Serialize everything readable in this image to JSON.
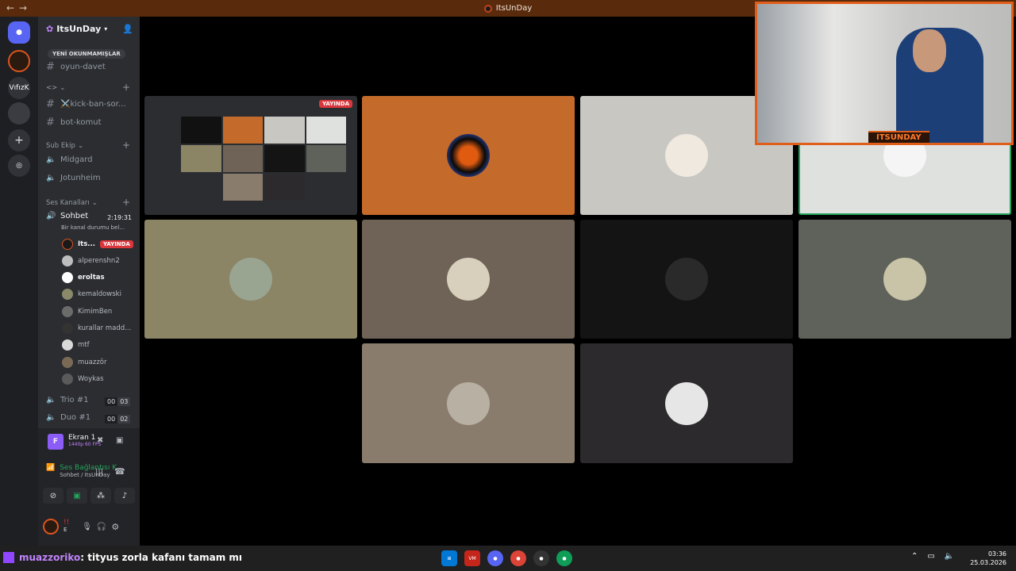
{
  "window": {
    "title": "ItsUnDay"
  },
  "rail": {
    "servers": [
      {
        "label": ""
      },
      {
        "label": ""
      },
      {
        "label": "VıfızK"
      },
      {
        "label": ""
      },
      {
        "label": "+"
      },
      {
        "label": ""
      }
    ]
  },
  "server": {
    "name": "ItsUnDay"
  },
  "unread_pill": "YENİ OKUNMAMIŞLAR",
  "channels_top": [
    {
      "name": "oyun-davet"
    }
  ],
  "cat1": {
    "label": "<>"
  },
  "channels_mid": [
    {
      "name": "⚔️kick-ban-sor..."
    },
    {
      "name": "bot-komut"
    }
  ],
  "sub_ekip": {
    "label": "Sub Ekip",
    "channels": [
      {
        "name": "Midgard"
      },
      {
        "name": "Jotunheim"
      }
    ]
  },
  "voice": {
    "label": "Ses Kanalları",
    "active": {
      "name": "Sohbet",
      "time": "2:19:31",
      "status": "Bir kanal durumu bel..."
    },
    "users": [
      {
        "name": "Its...",
        "badge": "YAYINDA",
        "color": "#1a1a1a"
      },
      {
        "name": "alperenshn2",
        "color": "#bdbdbd"
      },
      {
        "name": "eroltas",
        "color": "#ffffff"
      },
      {
        "name": "kemaldowski",
        "color": "#8a8a6a"
      },
      {
        "name": "KimimBen",
        "color": "#6b6b6b"
      },
      {
        "name": "kurallar madd...",
        "color": "#333333"
      },
      {
        "name": "mtf",
        "color": "#d9d9d9"
      },
      {
        "name": "muazzôr",
        "color": "#7a6a55"
      },
      {
        "name": "Woykas",
        "color": "#5a5a5a"
      }
    ],
    "others": [
      {
        "name": "Trio #1",
        "a": "00",
        "b": "03"
      },
      {
        "name": "Duo #1",
        "a": "00",
        "b": "02"
      }
    ]
  },
  "panel": {
    "screen": {
      "title": "Ekran 1",
      "sub": "1440p 60 FPS",
      "letter": "F"
    },
    "connection": {
      "title": "Ses Bağlantısı K",
      "sub": "Sohbet / ItsUnDay"
    },
    "user": {
      "name": "!!",
      "status": "E"
    }
  },
  "tiles": [
    {
      "badge": "YAYINDA",
      "bg": "#2b2d31"
    },
    {
      "bg": "#c46a2b"
    },
    {
      "bg": "#c9c7c1"
    },
    {
      "bg": "#dfe1df"
    },
    {
      "bg": "#8b8566"
    },
    {
      "bg": "#6e6356"
    },
    {
      "bg": "#141414"
    },
    {
      "bg": "#5f625b"
    },
    {
      "bg": "#8a7c6c"
    },
    {
      "bg": "#2c2a2c"
    }
  ],
  "cam": {
    "tag": "ITSUNDAY"
  },
  "chat": {
    "user": "muazzoriko",
    "message": ": tityus zorla kafanı tamam mı"
  },
  "clock": {
    "time": "03:36",
    "date": "25.03.2026"
  }
}
